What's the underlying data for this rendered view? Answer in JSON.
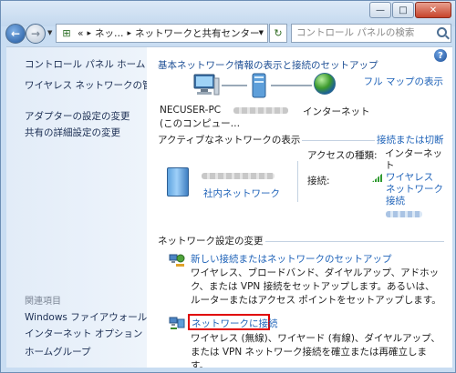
{
  "address": {
    "root": "«",
    "crumb1": "ネッ…",
    "crumb2": "ネットワークと共有センター"
  },
  "search": {
    "placeholder": "コントロール パネルの検索"
  },
  "sidebar": {
    "home": "コントロール パネル ホーム",
    "items": [
      {
        "label": "ワイヤレス ネットワークの管理"
      },
      {
        "label": "アダプターの設定の変更"
      },
      {
        "label": "共有の詳細設定の変更"
      }
    ],
    "related_title": "関連項目",
    "related": [
      {
        "label": "Windows ファイアウォール"
      },
      {
        "label": "インターネット オプション"
      },
      {
        "label": "ホームグループ"
      }
    ]
  },
  "main": {
    "title": "基本ネットワーク情報の表示と接続のセットアップ",
    "full_map": "フル マップの表示",
    "map": {
      "pc_name": "NECUSER-PC",
      "pc_sub": "(このコンピュー…",
      "internet": "インターネット"
    },
    "active": {
      "heading": "アクティブなネットワークの表示",
      "disconnect": "接続または切断",
      "network_name": "社内ネットワーク",
      "access_label": "アクセスの種類:",
      "access_value": "インターネット",
      "connection_label": "接続:",
      "connection_value": "ワイヤレス ネットワーク 接続"
    },
    "settings": {
      "heading": "ネットワーク設定の変更",
      "tasks": [
        {
          "title": "新しい接続またはネットワークのセットアップ",
          "desc": "ワイヤレス、ブロードバンド、ダイヤルアップ、アドホック、または VPN 接続をセットアップします。あるいは、ルーターまたはアクセス ポイントをセットアップします。"
        },
        {
          "title": "ネットワークに接続",
          "desc": "ワイヤレス (無線)、ワイヤード (有線)、ダイヤルアップ、または VPN ネットワーク接続を確立または再確立します。"
        }
      ]
    }
  },
  "icons": {
    "back": "back-arrow-icon",
    "forward": "forward-arrow-icon",
    "refresh": "refresh-icon",
    "search": "search-icon",
    "help": "help-icon"
  },
  "colors": {
    "link": "#1e62b8",
    "sidebar_bg": "#e2ecf8",
    "highlight": "#e00000"
  }
}
